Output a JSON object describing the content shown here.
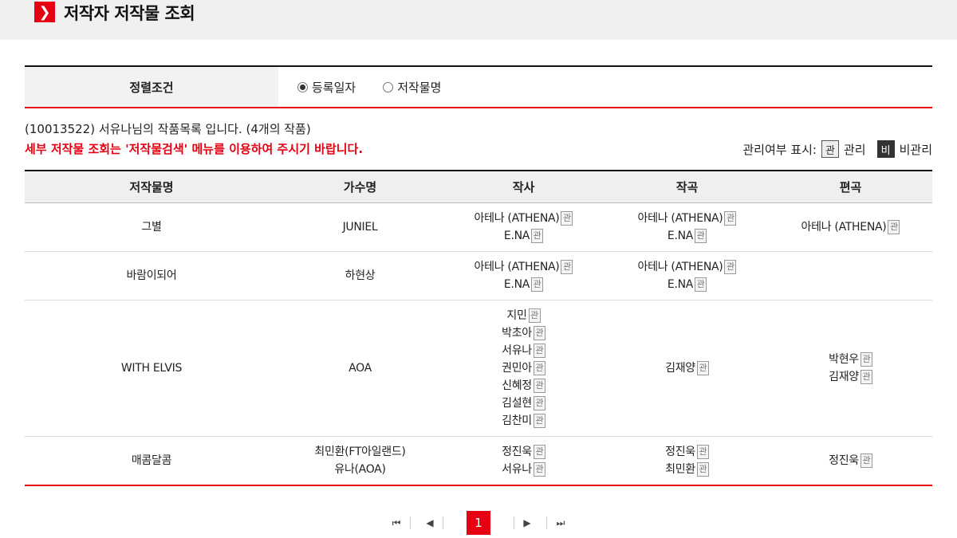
{
  "header": {
    "title": "저작자 저작물 조회"
  },
  "sort": {
    "label": "정렬조건",
    "options": [
      {
        "label": "등록일자",
        "selected": true
      },
      {
        "label": "저작물명",
        "selected": false
      }
    ]
  },
  "info": {
    "summary": "(10013522) 서유나님의 작품목록 입니다. (4개의 작품)",
    "notice": "세부 저작물 조회는 '저작물검색' 메뉴를 이용하여 주시기 바랍니다.",
    "legend_label": "관리여부 표시:",
    "managed_badge": "관",
    "managed_text": "관리",
    "unmanaged_badge": "비",
    "unmanaged_text": "비관리"
  },
  "table": {
    "headers": [
      "저작물명",
      "가수명",
      "작사",
      "작곡",
      "편곡"
    ],
    "rows": [
      {
        "title": "그별",
        "singer": [
          "JUNIEL"
        ],
        "lyrics": [
          "아테나 (ATHENA)",
          "E.NA"
        ],
        "composer": [
          "아테나 (ATHENA)",
          "E.NA"
        ],
        "arranger": [
          "아테나 (ATHENA)"
        ]
      },
      {
        "title": "바람이되어",
        "singer": [
          "하현상"
        ],
        "lyrics": [
          "아테나 (ATHENA)",
          "E.NA"
        ],
        "composer": [
          "아테나 (ATHENA)",
          "E.NA"
        ],
        "arranger": []
      },
      {
        "title": "WITH ELVIS",
        "singer": [
          "AOA"
        ],
        "lyrics": [
          "지민",
          "박초아",
          "서유나",
          "권민아",
          "신혜정",
          "김설현",
          "김찬미"
        ],
        "composer": [
          "김재양"
        ],
        "arranger": [
          "박현우",
          "김재양"
        ]
      },
      {
        "title": "매콤달콤",
        "singer": [
          "최민환(FT아일랜드)",
          "유나(AOA)"
        ],
        "lyrics": [
          "정진욱",
          "서유나"
        ],
        "composer": [
          "정진욱",
          "최민환"
        ],
        "arranger": [
          "정진욱"
        ]
      }
    ]
  },
  "pagination": {
    "current": "1",
    "first": "⏮",
    "prev": "◀",
    "next": "▶",
    "last": "⏭"
  },
  "colors": {
    "accent": "#e60012",
    "header_bg": "#f0f0f0"
  }
}
